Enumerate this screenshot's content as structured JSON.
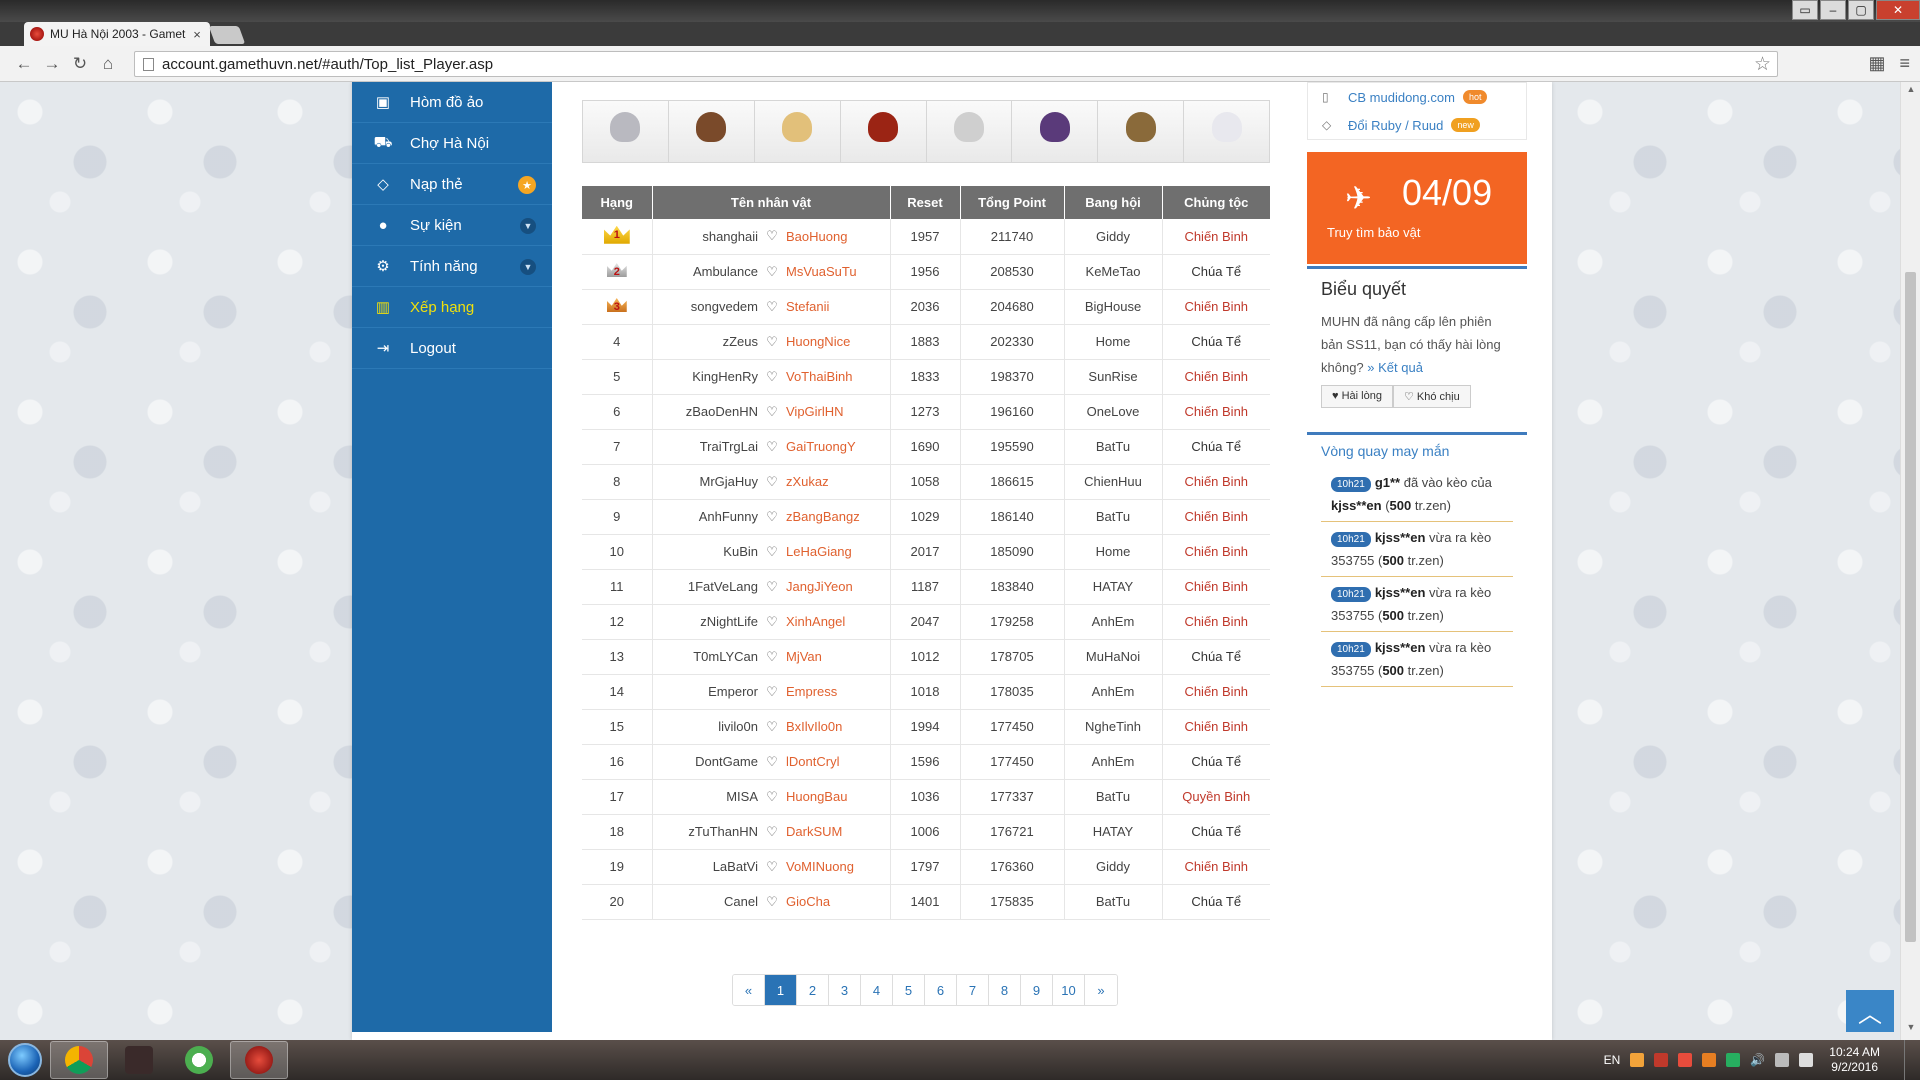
{
  "browser": {
    "tab_title": "MU Hà Nội 2003 - Gamet",
    "url": "account.gamethuvn.net/#auth/Top_list_Player.asp"
  },
  "sidebar": {
    "items": [
      {
        "label": "Hòm đồ ảo",
        "icon": "briefcase-icon"
      },
      {
        "label": "Chợ Hà Nội",
        "icon": "cart-icon"
      },
      {
        "label": "Nạp thẻ",
        "icon": "diamond-icon"
      },
      {
        "label": "Sự kiện",
        "icon": "android-icon"
      },
      {
        "label": "Tính năng",
        "icon": "gears-icon"
      },
      {
        "label": "Xếp hạng",
        "icon": "bar-chart-icon"
      },
      {
        "label": "Logout",
        "icon": "logout-icon"
      }
    ]
  },
  "ranking": {
    "headers": [
      "Hạng",
      "Tên nhân vật",
      "Reset",
      "Tổng Point",
      "Bang hội",
      "Chủng tộc"
    ],
    "rows": [
      {
        "rank": "1",
        "account": "shanghaii",
        "character": "BaoHuong",
        "reset": "1957",
        "points": "211740",
        "guild": "Giddy",
        "race": "Chiến Binh"
      },
      {
        "rank": "2",
        "account": "Ambulance",
        "character": "MsVuaSuTu",
        "reset": "1956",
        "points": "208530",
        "guild": "KeMeTao",
        "race": "Chúa Tể"
      },
      {
        "rank": "3",
        "account": "songvedem",
        "character": "Stefanii",
        "reset": "2036",
        "points": "204680",
        "guild": "BigHouse",
        "race": "Chiến Binh"
      },
      {
        "rank": "4",
        "account": "zZeus",
        "character": "HuongNice",
        "reset": "1883",
        "points": "202330",
        "guild": "Home",
        "race": "Chúa Tể"
      },
      {
        "rank": "5",
        "account": "KingHenRy",
        "character": "VoThaiBinh",
        "reset": "1833",
        "points": "198370",
        "guild": "SunRise",
        "race": "Chiến Binh"
      },
      {
        "rank": "6",
        "account": "zBaoDenHN",
        "character": "VipGirlHN",
        "reset": "1273",
        "points": "196160",
        "guild": "OneLove",
        "race": "Chiến Binh"
      },
      {
        "rank": "7",
        "account": "TraiTrgLai",
        "character": "GaiTruongY",
        "reset": "1690",
        "points": "195590",
        "guild": "BatTu",
        "race": "Chúa Tể"
      },
      {
        "rank": "8",
        "account": "MrGjaHuy",
        "character": "zXukaz",
        "reset": "1058",
        "points": "186615",
        "guild": "ChienHuu",
        "race": "Chiến Binh"
      },
      {
        "rank": "9",
        "account": "AnhFunny",
        "character": "zBangBangz",
        "reset": "1029",
        "points": "186140",
        "guild": "BatTu",
        "race": "Chiến Binh"
      },
      {
        "rank": "10",
        "account": "KuBin",
        "character": "LeHaGiang",
        "reset": "2017",
        "points": "185090",
        "guild": "Home",
        "race": "Chiến Binh"
      },
      {
        "rank": "11",
        "account": "1FatVeLang",
        "character": "JangJiYeon",
        "reset": "1187",
        "points": "183840",
        "guild": "HATAY",
        "race": "Chiến Binh"
      },
      {
        "rank": "12",
        "account": "zNightLife",
        "character": "XinhAngel",
        "reset": "2047",
        "points": "179258",
        "guild": "AnhEm",
        "race": "Chiến Binh"
      },
      {
        "rank": "13",
        "account": "T0mLYCan",
        "character": "MjVan",
        "reset": "1012",
        "points": "178705",
        "guild": "MuHaNoi",
        "race": "Chúa Tể"
      },
      {
        "rank": "14",
        "account": "Emperor",
        "character": "Empress",
        "reset": "1018",
        "points": "178035",
        "guild": "AnhEm",
        "race": "Chiến Binh"
      },
      {
        "rank": "15",
        "account": "livilo0n",
        "character": "BxIlvIlo0n",
        "reset": "1994",
        "points": "177450",
        "guild": "NgheTinh",
        "race": "Chiến Binh"
      },
      {
        "rank": "16",
        "account": "DontGame",
        "character": "lDontCryl",
        "reset": "1596",
        "points": "177450",
        "guild": "AnhEm",
        "race": "Chúa Tể"
      },
      {
        "rank": "17",
        "account": "MISA",
        "character": "HuongBau",
        "reset": "1036",
        "points": "177337",
        "guild": "BatTu",
        "race": "Quyền Binh"
      },
      {
        "rank": "18",
        "account": "zTuThanHN",
        "character": "DarkSUM",
        "reset": "1006",
        "points": "176721",
        "guild": "HATAY",
        "race": "Chúa Tể"
      },
      {
        "rank": "19",
        "account": "LaBatVi",
        "character": "VoMINuong",
        "reset": "1797",
        "points": "176360",
        "guild": "Giddy",
        "race": "Chiến Binh"
      },
      {
        "rank": "20",
        "account": "Canel",
        "character": "GioCha",
        "reset": "1401",
        "points": "175835",
        "guild": "BatTu",
        "race": "Chúa Tể"
      }
    ]
  },
  "pagination": {
    "prev": "«",
    "pages": [
      "1",
      "2",
      "3",
      "4",
      "5",
      "6",
      "7",
      "8",
      "9",
      "10"
    ],
    "next": "»",
    "current": "1"
  },
  "right": {
    "links": [
      {
        "label": "CB mudidong.com",
        "badge": "hot",
        "icon": "mobile-icon"
      },
      {
        "label": "Đổi Ruby / Ruud",
        "badge": "new",
        "icon": "diamond-icon"
      }
    ],
    "promo": {
      "date": "04/09",
      "caption": "Truy tìm bảo vật"
    },
    "poll": {
      "title": "Biểu quyết",
      "text": "MUHN đã nâng cấp lên phiên bản SS11, bạn có thấy hài lòng không?",
      "result_link": "» Kết quả",
      "option1": "Hài lòng",
      "option2": "Khó chịu"
    },
    "lucky": {
      "title": "Vòng quay may mắn",
      "items": [
        {
          "time": "10h21",
          "user": "g1**",
          "text": " đã vào kèo của ",
          "target": "kjss**en",
          "amount": "500",
          "unit": " tr.zen)"
        },
        {
          "time": "10h21",
          "user": "kjss**en",
          "text": " vừa ra kèo 353755 (",
          "target": "",
          "amount": "500",
          "unit": " tr.zen)"
        },
        {
          "time": "10h21",
          "user": "kjss**en",
          "text": " vừa ra kèo 353755 (",
          "target": "",
          "amount": "500",
          "unit": " tr.zen)"
        },
        {
          "time": "10h21",
          "user": "kjss**en",
          "text": " vừa ra kèo 353755 (",
          "target": "",
          "amount": "500",
          "unit": " tr.zen)"
        }
      ]
    }
  },
  "taskbar": {
    "lang": "EN",
    "time": "10:24 AM",
    "date": "9/2/2016"
  },
  "colors": {
    "sidebar": "#1e6aa8",
    "accent_orange": "#f36523",
    "link_blue": "#2a73b5",
    "race_red": "#c0392b"
  }
}
